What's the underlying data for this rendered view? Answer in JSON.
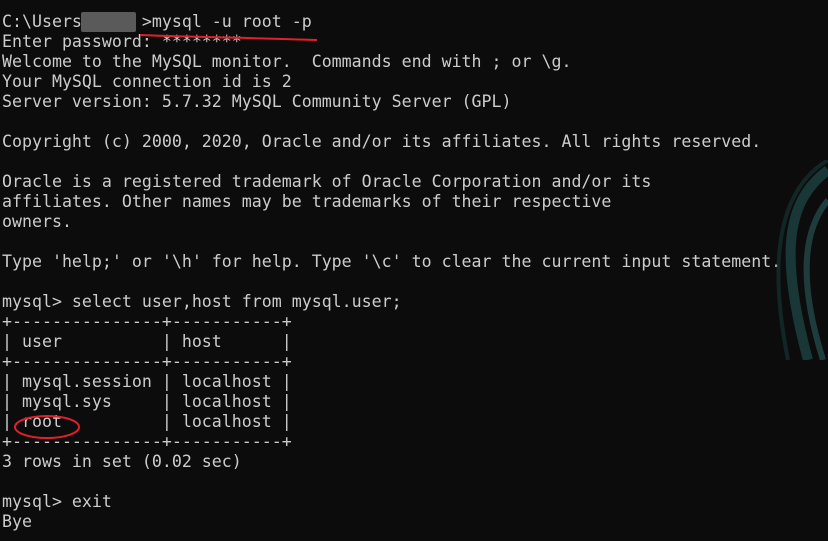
{
  "terminal": {
    "lines": [
      "C:\\Users      >mysql -u root -p",
      "Enter password: ********",
      "Welcome to the MySQL monitor.  Commands end with ; or \\g.",
      "Your MySQL connection id is 2",
      "Server version: 5.7.32 MySQL Community Server (GPL)",
      "",
      "Copyright (c) 2000, 2020, Oracle and/or its affiliates. All rights reserved.",
      "",
      "Oracle is a registered trademark of Oracle Corporation and/or its",
      "affiliates. Other names may be trademarks of their respective",
      "owners.",
      "",
      "Type 'help;' or '\\h' for help. Type '\\c' to clear the current input statement.",
      "",
      "mysql> select user,host from mysql.user;",
      "+---------------+-----------+",
      "| user          | host      |",
      "+---------------+-----------+",
      "| mysql.session | localhost |",
      "| mysql.sys     | localhost |",
      "| root          | localhost |",
      "+---------------+-----------+",
      "3 rows in set (0.02 sec)",
      "",
      "mysql> exit",
      "Bye"
    ]
  },
  "colors": {
    "background": "#0c0c0c",
    "text": "#cccccc",
    "annotation": "#e0202a"
  }
}
